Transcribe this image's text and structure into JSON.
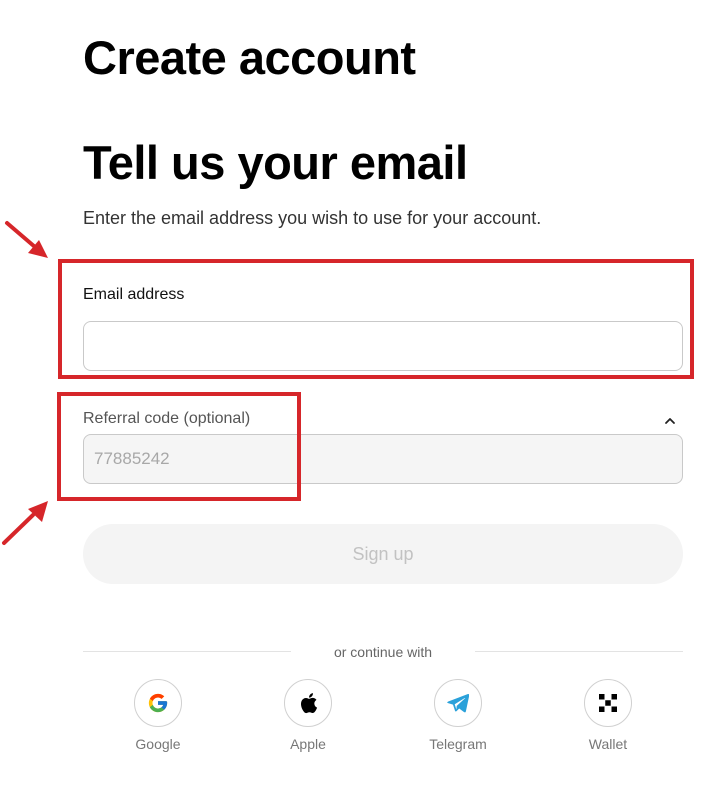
{
  "header": {
    "title": "Create account"
  },
  "step": {
    "title": "Tell us your email",
    "subtitle": "Enter the email address you wish to use for your account."
  },
  "form": {
    "email": {
      "label": "Email address",
      "value": "",
      "placeholder": ""
    },
    "referral": {
      "label": "Referral code (optional)",
      "value": "",
      "placeholder": "77885242",
      "toggle_icon": "chevron-up-icon"
    },
    "signup_label": "Sign up"
  },
  "divider": {
    "text": "or continue with"
  },
  "providers": [
    {
      "label": "Google",
      "icon": "google-icon"
    },
    {
      "label": "Apple",
      "icon": "apple-icon"
    },
    {
      "label": "Telegram",
      "icon": "telegram-icon"
    },
    {
      "label": "Wallet",
      "icon": "wallet-icon"
    }
  ],
  "annotations": {
    "color": "#d6262a"
  },
  "colors": {
    "telegram": "#2aa1da",
    "disabled_button_bg": "#f4f4f4",
    "disabled_button_text": "#c2c2c2"
  }
}
